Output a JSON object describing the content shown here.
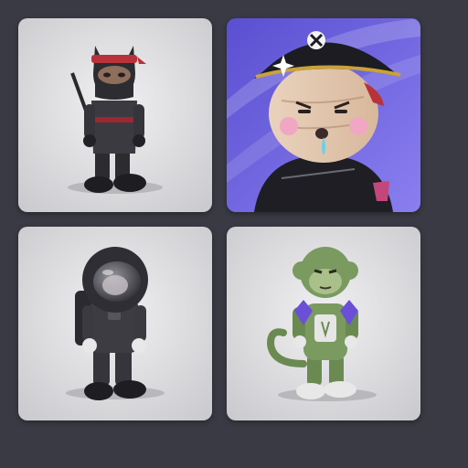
{
  "gallery": {
    "background": "#3a3a44",
    "items": [
      {
        "icon": "ninja-cat-figure",
        "background": "#dcdcdf"
      },
      {
        "icon": "pirate-character-portrait",
        "background": "#6e62d9"
      },
      {
        "icon": "astronaut-figure",
        "background": "#dcdcdf"
      },
      {
        "icon": "monkey-figure",
        "background": "#dcdcdf"
      }
    ]
  }
}
